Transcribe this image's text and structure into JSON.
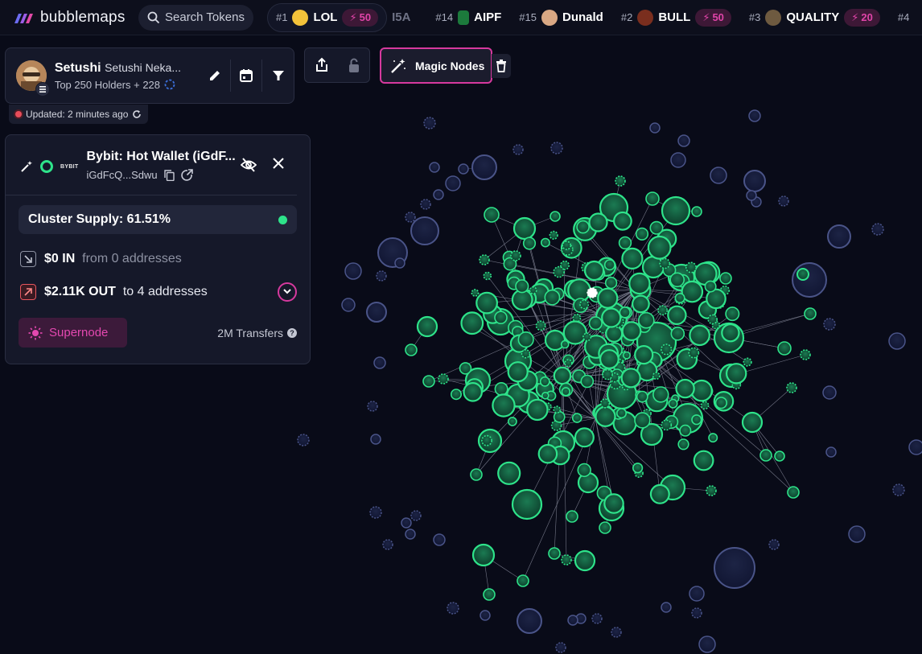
{
  "app": {
    "name": "bubblemaps"
  },
  "search": {
    "placeholder": "Search Tokens"
  },
  "ticker": [
    {
      "rank": "#1",
      "name": "LOL",
      "boost": "50",
      "avatar_color": "#f3c23a"
    },
    {
      "rank": "",
      "name": "I5A",
      "boost": "",
      "avatar_color": ""
    },
    {
      "rank": "#14",
      "name": "AIPF",
      "boost": "",
      "avatar_color": "#1c7a3c"
    },
    {
      "rank": "#15",
      "name": "Dunald",
      "boost": "",
      "avatar_color": "#d9a884"
    },
    {
      "rank": "#2",
      "name": "BULL",
      "boost": "50",
      "avatar_color": "#7a2e1e"
    },
    {
      "rank": "#3",
      "name": "QUALITY",
      "boost": "20",
      "avatar_color": "#6e5a40"
    },
    {
      "rank": "#4",
      "name": "",
      "boost": "",
      "avatar_color": ""
    }
  ],
  "token": {
    "symbol": "Setushi",
    "full_name": "Setushi Neka...",
    "holders": "Top 250 Holders + 228",
    "updated": "Updated: 2 minutes ago"
  },
  "toolbar": {
    "magic_label": "Magic Nodes"
  },
  "wallet": {
    "exchange": "BYBIT",
    "name": "Bybit: Hot Wallet (iGdF...",
    "address": "iGdFcQ...Sdwu",
    "cluster_supply": "Cluster Supply: 61.51%",
    "in_amount": "$0 IN",
    "in_from": "from 0 addresses",
    "out_amount": "$2.11K OUT",
    "out_to": "to 4 addresses",
    "supernode_label": "Supernode",
    "transfers": "2M Transfers"
  },
  "colors": {
    "background": "#090b18",
    "cluster_green": "#2ee38a",
    "accent_pink": "#d6399e",
    "neutral_bubble": "#3a4472"
  }
}
